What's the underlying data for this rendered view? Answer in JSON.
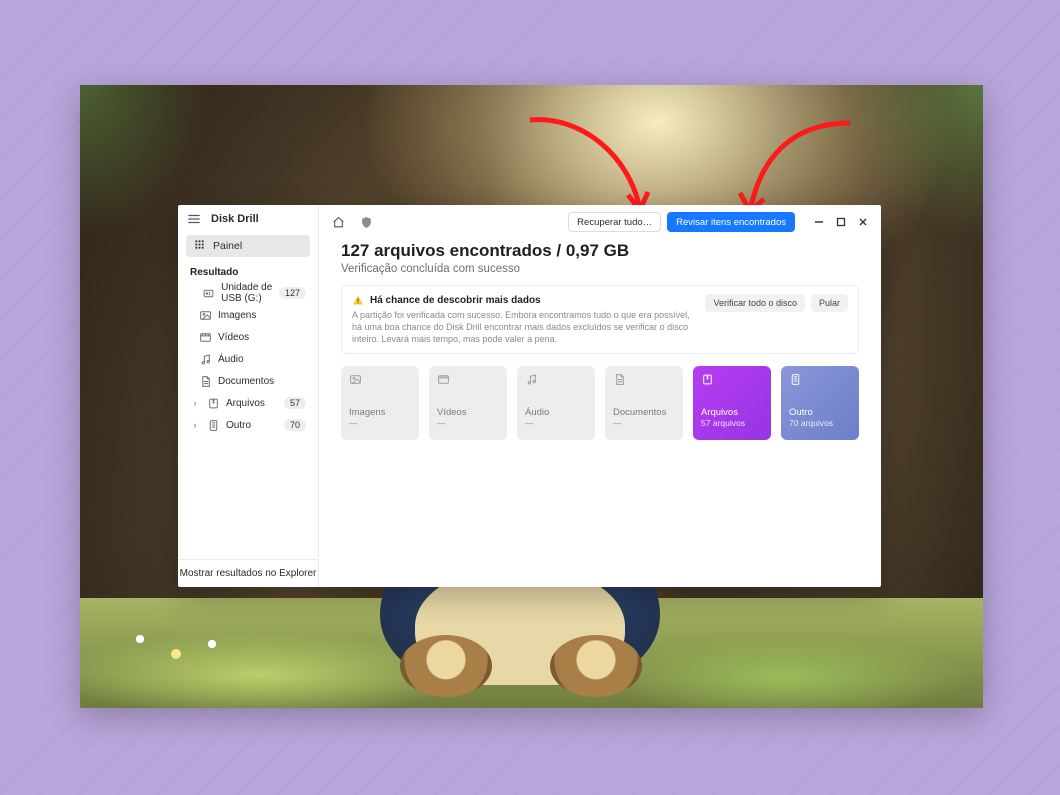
{
  "colors": {
    "accent": "#1677ff",
    "purple": "#a338ea",
    "indigo": "#7686cf",
    "arrow": "#ff1a1a"
  },
  "app_name": "Disk Drill",
  "sidebar": {
    "tab_label": "Painel",
    "section_label": "Resultado",
    "footer_label": "Mostrar resultados no Explorer",
    "items": [
      {
        "icon": "usb",
        "label": "Unidade de USB (G:)",
        "count": 127,
        "chevron": false,
        "child": false
      },
      {
        "icon": "image",
        "label": "Imagens",
        "count": null,
        "chevron": false,
        "child": true
      },
      {
        "icon": "video",
        "label": "Vídeos",
        "count": null,
        "chevron": false,
        "child": true
      },
      {
        "icon": "audio",
        "label": "Áudio",
        "count": null,
        "chevron": false,
        "child": true
      },
      {
        "icon": "doc",
        "label": "Documentos",
        "count": null,
        "chevron": false,
        "child": true
      },
      {
        "icon": "archive",
        "label": "Arquivos",
        "count": 57,
        "chevron": true,
        "child": false
      },
      {
        "icon": "other",
        "label": "Outro",
        "count": 70,
        "chevron": true,
        "child": false
      }
    ]
  },
  "topbar": {
    "recover_label": "Recuperar tudo…",
    "review_label": "Revisar itens encontrados"
  },
  "headline": {
    "title": "127 arquivos encontrados / 0,97 GB",
    "subtitle": "Verificação concluída com sucesso"
  },
  "info": {
    "title": "Há chance de descobrir mais dados",
    "body": "A partição foi verificada com sucesso. Embora encontramos tudo o que era possível, há uma boa chance do Disk Drill encontrar mais dados excluídos se verificar o disco inteiro. Levará mais tempo, mas pode valer a pena.",
    "verify_label": "Verificar todo o disco",
    "skip_label": "Pular"
  },
  "cards": [
    {
      "icon": "image",
      "title": "Imagens",
      "subtitle": "—",
      "variant": "gray"
    },
    {
      "icon": "video",
      "title": "Vídeos",
      "subtitle": "—",
      "variant": "gray"
    },
    {
      "icon": "audio",
      "title": "Áudio",
      "subtitle": "—",
      "variant": "gray"
    },
    {
      "icon": "doc",
      "title": "Documentos",
      "subtitle": "—",
      "variant": "gray"
    },
    {
      "icon": "archive",
      "title": "Arquivos",
      "subtitle": "57 arquivos",
      "variant": "purple"
    },
    {
      "icon": "other",
      "title": "Outro",
      "subtitle": "70 arquivos",
      "variant": "blue"
    }
  ]
}
